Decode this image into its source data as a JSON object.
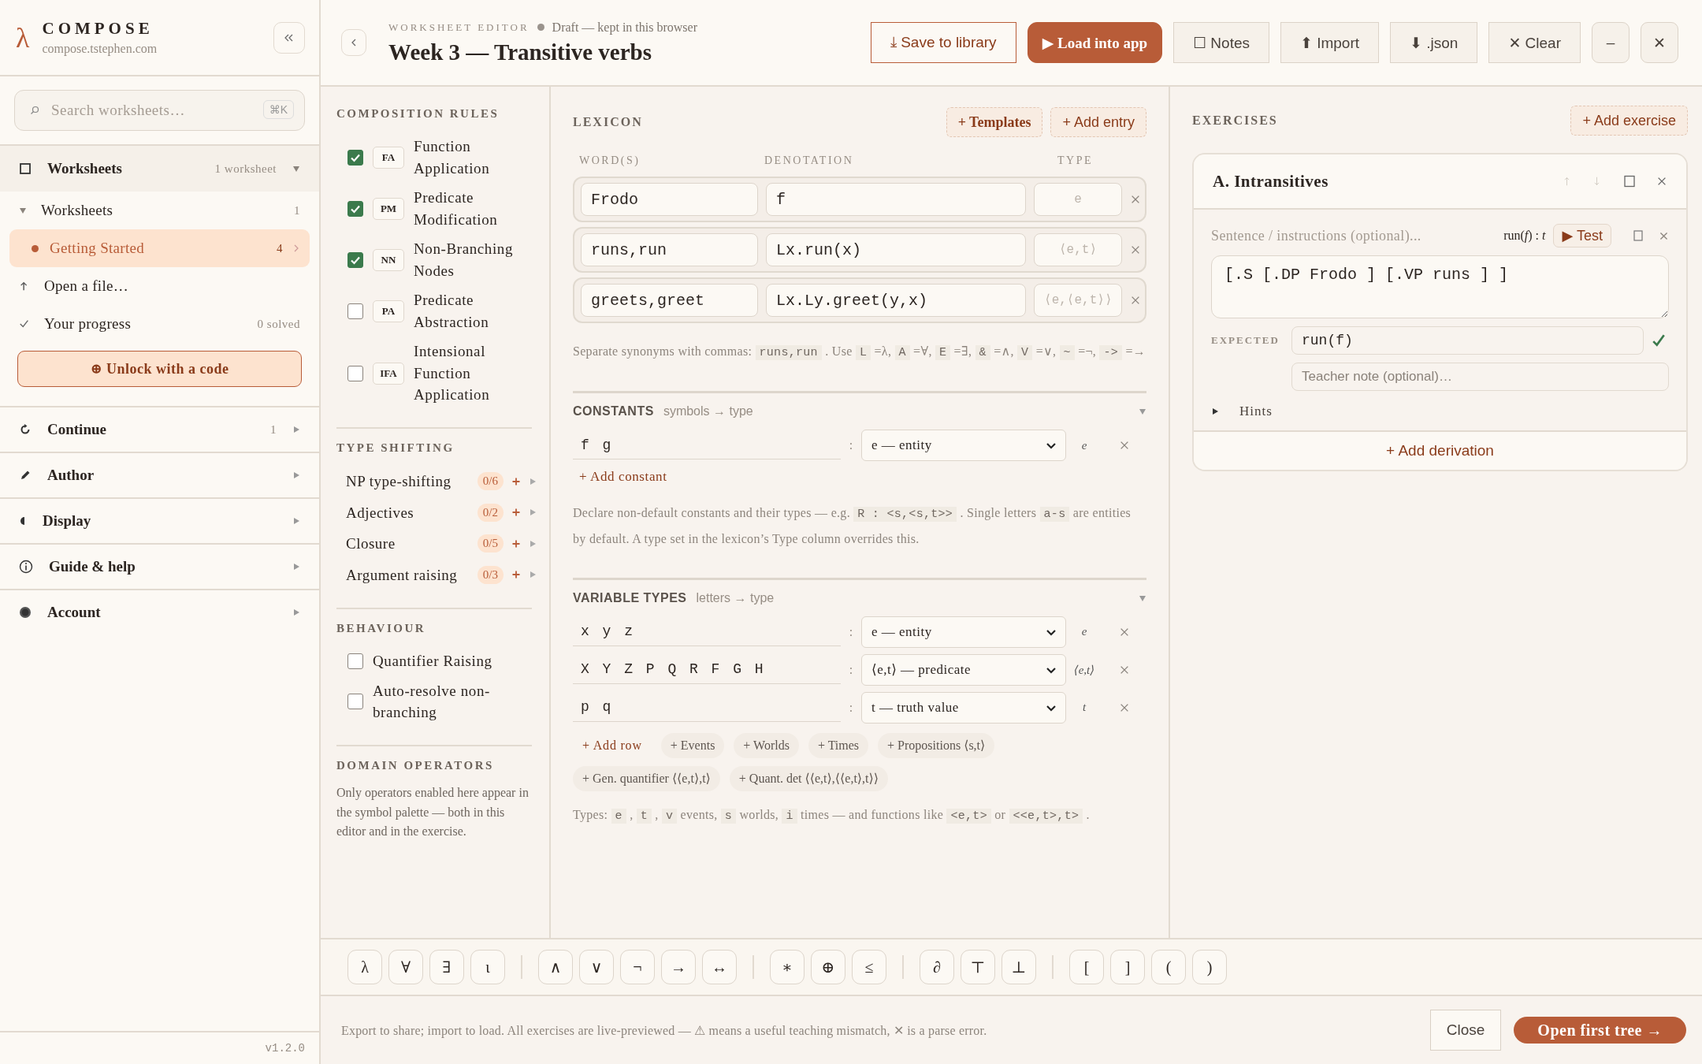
{
  "sidebar": {
    "brand": {
      "logo": "λ",
      "name": "COMPOSE",
      "domain": "compose.tstephen.com"
    },
    "search": {
      "placeholder": "Search worksheets…",
      "shortcut": "⌘K"
    },
    "library": {
      "label": "Worksheets",
      "count": "1 worksheet",
      "expanded": true,
      "group": {
        "label": "Worksheets",
        "count": "1",
        "expanded": true
      },
      "items": [
        {
          "label": "Getting Started",
          "count": "4",
          "selected": true
        }
      ],
      "actions": [
        {
          "kind": "open",
          "label": "Open a file…"
        },
        {
          "kind": "progress",
          "label": "Your progress",
          "count": "0 solved"
        }
      ],
      "unlock": "⊕ Unlock with a code"
    },
    "sections": [
      {
        "kind": "continue",
        "label": "Continue",
        "count": "1",
        "expanded": false
      },
      {
        "kind": "author",
        "label": "Author",
        "expanded": false
      },
      {
        "kind": "display",
        "label": "Display",
        "expanded": false
      },
      {
        "kind": "help",
        "label": "Guide & help",
        "expanded": false
      },
      {
        "kind": "account",
        "label": "Account",
        "expanded": false
      }
    ],
    "version": "v1.2.0"
  },
  "header": {
    "eyebrow": "WORKSHEET EDITOR",
    "status": "Draft — kept in this browser",
    "title": "Week 3 — Transitive verbs",
    "buttons": [
      {
        "kind": "outline",
        "label": "⤓ Save to library"
      },
      {
        "kind": "primary",
        "label": "▶ Load into app"
      },
      {
        "kind": "plain",
        "label": "☐ Notes"
      },
      {
        "kind": "plain",
        "label": "⬆ Import"
      },
      {
        "kind": "plain",
        "label": "⬇ .json"
      },
      {
        "kind": "plain",
        "label": "✕ Clear"
      },
      {
        "kind": "square",
        "label": "–"
      },
      {
        "kind": "square",
        "label": "✕"
      }
    ]
  },
  "composition_rules": {
    "title": "COMPOSITION RULES",
    "rules": [
      {
        "abbr": "FA",
        "name": "Function Application",
        "checked": true
      },
      {
        "abbr": "PM",
        "name": "Predicate Modification",
        "checked": true
      },
      {
        "abbr": "NN",
        "name": "Non-Branching Nodes",
        "checked": true
      },
      {
        "abbr": "PA",
        "name": "Predicate Abstraction",
        "checked": false
      },
      {
        "abbr": "IFA",
        "name": "Intensional Function Application",
        "checked": false
      }
    ]
  },
  "type_shifting": {
    "title": "TYPE SHIFTING",
    "items": [
      {
        "label": "NP type-shifting",
        "count": "0/6"
      },
      {
        "label": "Adjectives",
        "count": "0/2"
      },
      {
        "label": "Closure",
        "count": "0/5"
      },
      {
        "label": "Argument raising",
        "count": "0/3"
      }
    ]
  },
  "behaviour": {
    "title": "BEHAVIOUR",
    "items": [
      {
        "label": "Quantifier Raising",
        "checked": false
      },
      {
        "label": "Auto-resolve non-branching",
        "checked": false
      }
    ]
  },
  "domain_operators": {
    "title": "DOMAIN OPERATORS",
    "text": "Only operators enabled here appear in the symbol palette — both in this editor and in the exercise."
  },
  "lexicon": {
    "title": "LEXICON",
    "buttons": [
      {
        "kind": "templates",
        "label": "+ Templates"
      },
      {
        "kind": "add",
        "label": "+ Add entry"
      }
    ],
    "columns": [
      "WORD(S)",
      "DENOTATION",
      "TYPE"
    ],
    "entries": [
      {
        "words": "Frodo",
        "denotation": "f",
        "type_placeholder": "e"
      },
      {
        "words": "runs,run",
        "denotation": "Lx.run(x)",
        "type_placeholder": "⟨e,t⟩"
      },
      {
        "words": "greets,greet",
        "denotation": "Lx.Ly.greet(y,x)",
        "type_placeholder": "⟨e,⟨e,t⟩⟩"
      }
    ],
    "note": [
      {
        "kind": "text",
        "text": "Separate synonyms with commas: "
      },
      {
        "kind": "code",
        "text": "runs,run"
      },
      {
        "kind": "text",
        "text": " . Use "
      },
      {
        "kind": "code",
        "text": "L"
      },
      {
        "kind": "text",
        "text": " =λ, "
      },
      {
        "kind": "code",
        "text": "A"
      },
      {
        "kind": "text",
        "text": " =∀, "
      },
      {
        "kind": "code",
        "text": "E"
      },
      {
        "kind": "text",
        "text": " =∃, "
      },
      {
        "kind": "code",
        "text": "&"
      },
      {
        "kind": "text",
        "text": " =∧, "
      },
      {
        "kind": "code",
        "text": "V"
      },
      {
        "kind": "text",
        "text": " =∨, "
      },
      {
        "kind": "code",
        "text": "~"
      },
      {
        "kind": "text",
        "text": " =¬, "
      },
      {
        "kind": "code",
        "text": "->"
      },
      {
        "kind": "text",
        "text": " =→"
      }
    ]
  },
  "constants": {
    "title": "CONSTANTS",
    "subtitle": "symbols → type",
    "expanded": true,
    "separator": ":",
    "rows": [
      {
        "symbols": "f g",
        "type": "e — entity",
        "preview": "e"
      }
    ],
    "add": "+ Add constant",
    "note": [
      {
        "kind": "text",
        "text": "Declare non-default constants and their types — e.g. "
      },
      {
        "kind": "code",
        "text": "R : <s,<s,t>>"
      },
      {
        "kind": "text",
        "text": " . Single letters "
      },
      {
        "kind": "code",
        "text": "a-s"
      },
      {
        "kind": "text",
        "text": " are entities by default. A type set in the lexicon’s Type column overrides this."
      }
    ]
  },
  "variable_types": {
    "title": "VARIABLE TYPES",
    "subtitle": "letters → type",
    "expanded": true,
    "separator": ":",
    "rows": [
      {
        "symbols": "x y z",
        "type": "e — entity",
        "preview": "e"
      },
      {
        "symbols": "X Y Z P Q R F G H",
        "type": "⟨e,t⟩ — predicate",
        "preview": "⟨e,t⟩"
      },
      {
        "symbols": "p q",
        "type": "t — truth value",
        "preview": "t"
      }
    ],
    "chips": [
      {
        "kind": "add",
        "label": "+ Add row"
      },
      {
        "kind": "preset",
        "label": "+ Events"
      },
      {
        "kind": "preset",
        "label": "+ Worlds"
      },
      {
        "kind": "preset",
        "label": "+ Times"
      },
      {
        "kind": "preset",
        "label": "+ Propositions ⟨s,t⟩"
      },
      {
        "kind": "preset",
        "label": "+ Gen. quantifier ⟨⟨e,t⟩,t⟩"
      },
      {
        "kind": "preset",
        "label": "+ Quant. det ⟨⟨e,t⟩,⟨⟨e,t⟩,t⟩⟩"
      }
    ],
    "note": [
      {
        "kind": "text",
        "text": "Types: "
      },
      {
        "kind": "code",
        "text": "e"
      },
      {
        "kind": "text",
        "text": " , "
      },
      {
        "kind": "code",
        "text": "t"
      },
      {
        "kind": "text",
        "text": " , "
      },
      {
        "kind": "code",
        "text": "v"
      },
      {
        "kind": "text",
        "text": " events, "
      },
      {
        "kind": "code",
        "text": "s"
      },
      {
        "kind": "text",
        "text": " worlds, "
      },
      {
        "kind": "code",
        "text": "i"
      },
      {
        "kind": "text",
        "text": " times — and functions like "
      },
      {
        "kind": "code",
        "text": "<e,t>"
      },
      {
        "kind": "text",
        "text": " or "
      },
      {
        "kind": "code",
        "text": "<<e,t>,t>"
      },
      {
        "kind": "text",
        "text": " ."
      }
    ]
  },
  "exercises": {
    "title": "EXERCISES",
    "add": "+ Add exercise",
    "cards": [
      {
        "title": "A. Intransitives",
        "actions": [
          {
            "kind": "up",
            "disabled": true
          },
          {
            "kind": "down",
            "disabled": true
          },
          {
            "kind": "duplicate",
            "disabled": false
          },
          {
            "kind": "delete",
            "disabled": false
          }
        ],
        "derivations": [
          {
            "placeholder": "Sentence / instructions (optional)...",
            "formula": "run(*f*) : *t*",
            "test": "▶ Test",
            "tree": "[.S [.DP Frodo ] [.VP runs ] ]",
            "expected_label": "EXPECTED",
            "expected": "run(f)",
            "expected_ok": true,
            "note_placeholder": "Teacher note (optional)…",
            "hints": {
              "label": "Hints",
              "expanded": false
            }
          }
        ],
        "add_derivation": "+ Add derivation"
      }
    ]
  },
  "palette": [
    [
      "λ",
      "∀",
      "∃",
      "ι"
    ],
    [
      "∧",
      "∨",
      "¬",
      "→",
      "↔"
    ],
    [
      "∗",
      "⊕",
      "≤"
    ],
    [
      "∂",
      "⊤",
      "⊥"
    ],
    [
      "[",
      "]",
      "(",
      ")"
    ]
  ],
  "footer": {
    "text": "Export to share; import to load. All exercises are live-previewed — ⚠ means a useful teaching mismatch, ✕ is a parse error.",
    "buttons": [
      {
        "kind": "plain",
        "label": "Close"
      },
      {
        "kind": "primary",
        "label": "Open first tree →"
      }
    ]
  }
}
